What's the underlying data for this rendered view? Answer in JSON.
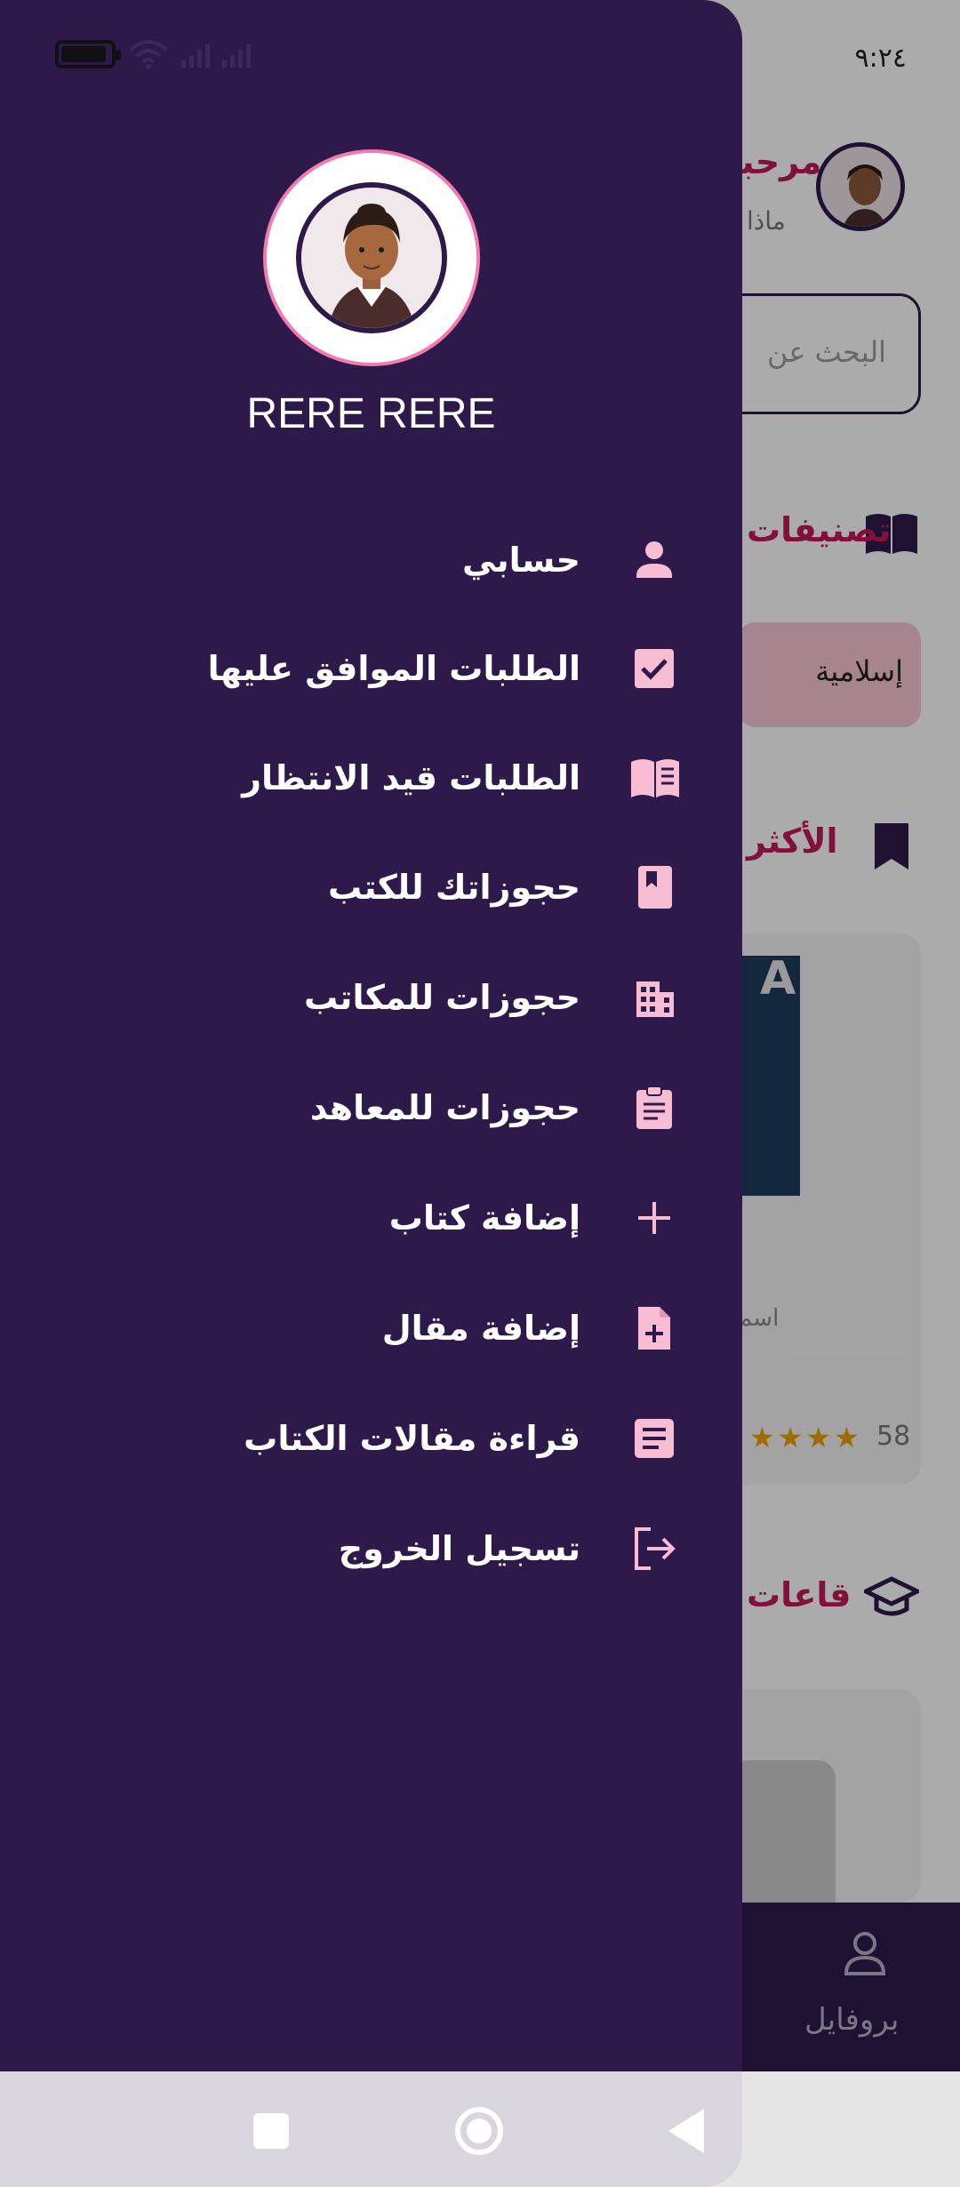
{
  "status_bar": {
    "time": "٩:٢٤"
  },
  "background_app": {
    "greeting": "مرحبا",
    "subtitle": "ماذا",
    "search_placeholder": "البحث عن",
    "categories_title": "تصنيفات",
    "category_chip": "إسلامية",
    "popular_title": "الأكثر",
    "book_cover_text": "AL",
    "book_name": "اسم",
    "rating_stars": "★★★★",
    "rating_count": "58",
    "halls_title": "قاعات",
    "bottom_nav_profile": "بروفايل"
  },
  "drawer": {
    "user_name": "RERE RERE",
    "menu": [
      {
        "label": "حسابي",
        "icon": "person-icon"
      },
      {
        "label": "الطلبات الموافق عليها",
        "icon": "checkbox-icon"
      },
      {
        "label": "الطلبات قيد الانتظار",
        "icon": "open-book-icon"
      },
      {
        "label": "حجوزاتك للكتب",
        "icon": "bookmark-book-icon"
      },
      {
        "label": "حجوزات للمكاتب",
        "icon": "building-icon"
      },
      {
        "label": "حجوزات للمعاهد",
        "icon": "clipboard-icon"
      },
      {
        "label": "إضافة كتاب",
        "icon": "plus-icon"
      },
      {
        "label": "إضافة مقال",
        "icon": "add-file-icon"
      },
      {
        "label": "قراءة مقالات الكتاب",
        "icon": "article-icon"
      },
      {
        "label": "تسجيل الخروج",
        "icon": "logout-icon"
      }
    ]
  },
  "colors": {
    "drawer_bg": "#2d1a4a",
    "icon_pink": "#f8bcd3",
    "accent": "#c2185b"
  }
}
